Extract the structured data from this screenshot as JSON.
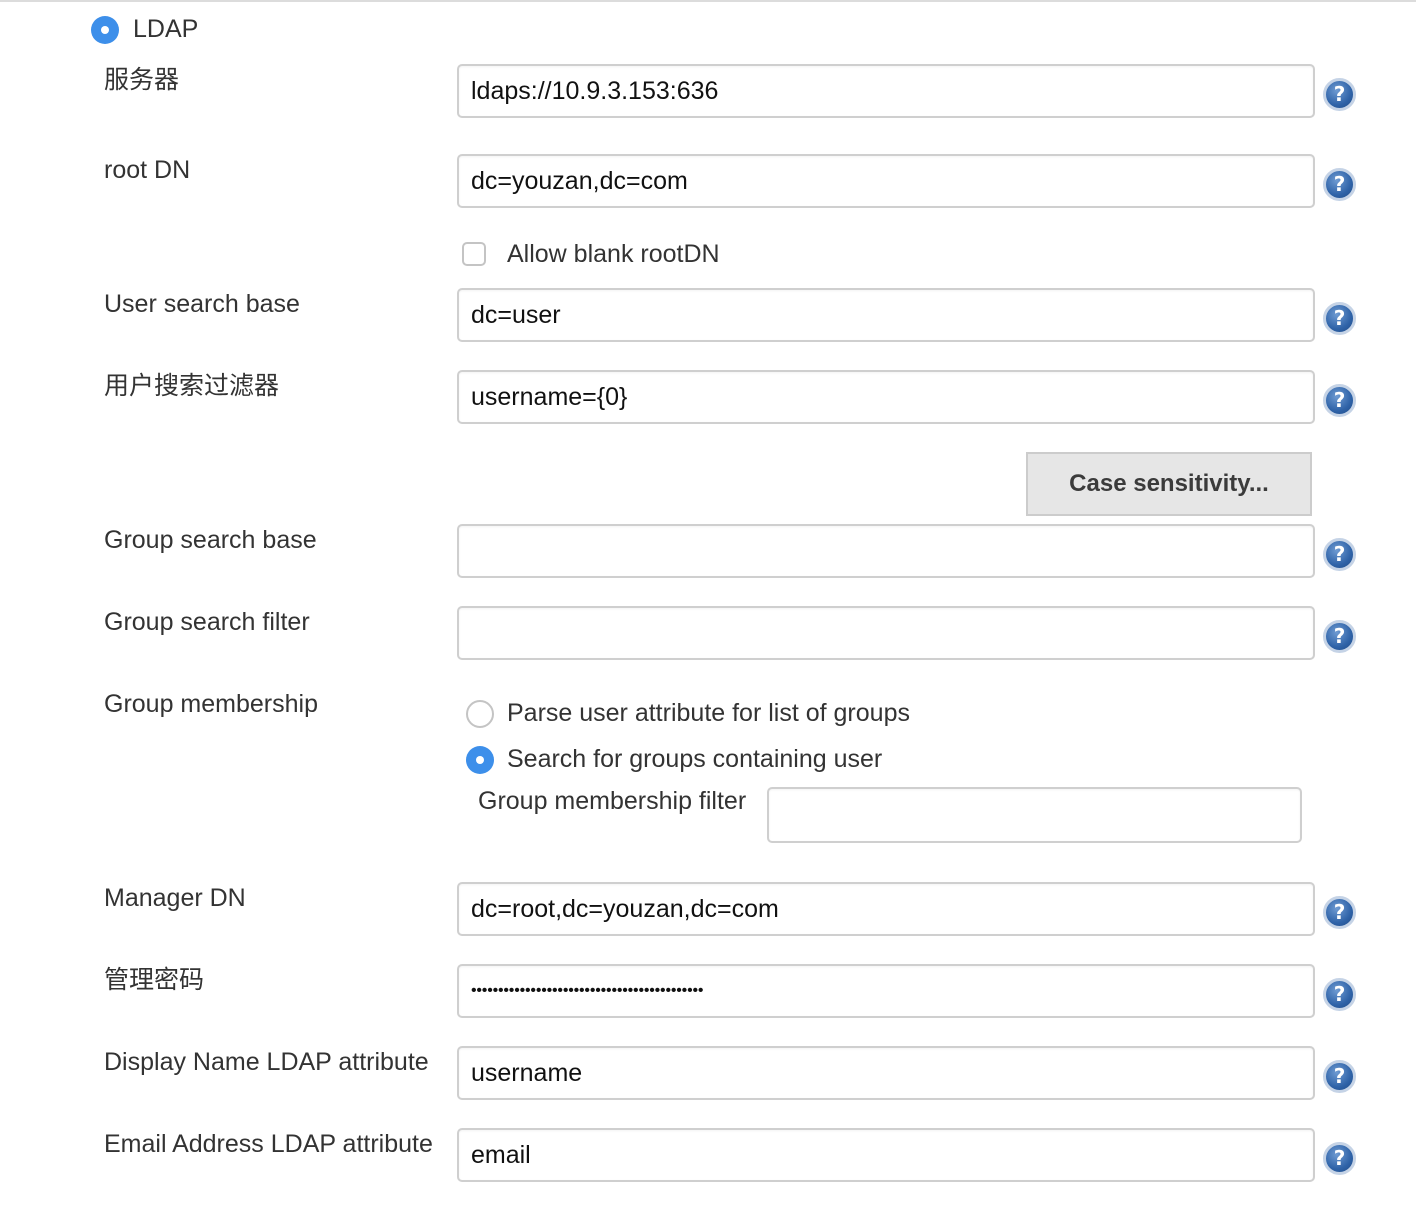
{
  "ldap_radio": {
    "label": "LDAP",
    "selected": true
  },
  "fields": {
    "server": {
      "label": "服务器",
      "value": "ldaps://10.9.3.153:636"
    },
    "root_dn": {
      "label": "root DN",
      "value": "dc=youzan,dc=com"
    },
    "allow_blank_rootdn": {
      "label": "Allow blank rootDN",
      "checked": false
    },
    "user_search_base": {
      "label": "User search base",
      "value": "dc=user"
    },
    "user_search_filter": {
      "label": "用户搜索过滤器",
      "value": "username={0}"
    },
    "case_sensitivity_button": "Case sensitivity...",
    "group_search_base": {
      "label": "Group search base",
      "value": ""
    },
    "group_search_filter": {
      "label": "Group search filter",
      "value": ""
    },
    "group_membership": {
      "label": "Group membership",
      "option_parse": "Parse user attribute for list of groups",
      "option_search": "Search for groups containing user",
      "selected": "search",
      "filter_label": "Group membership filter",
      "filter_value": ""
    },
    "manager_dn": {
      "label": "Manager DN",
      "value": "dc=root,dc=youzan,dc=com"
    },
    "manager_password": {
      "label": "管理密码",
      "value": "•••••••••••••••••••••••••••••••••••••••••••"
    },
    "display_name_attr": {
      "label": "Display Name LDAP attribute",
      "value": "username"
    },
    "email_attr": {
      "label": "Email Address LDAP attribute",
      "value": "email"
    }
  },
  "icons": {
    "help": "help-question-icon",
    "help_glyph": "?"
  },
  "colors": {
    "radio_selected": "#3d8fea",
    "help_icon": "#2f63a8",
    "field_border": "#cfcfcf"
  }
}
